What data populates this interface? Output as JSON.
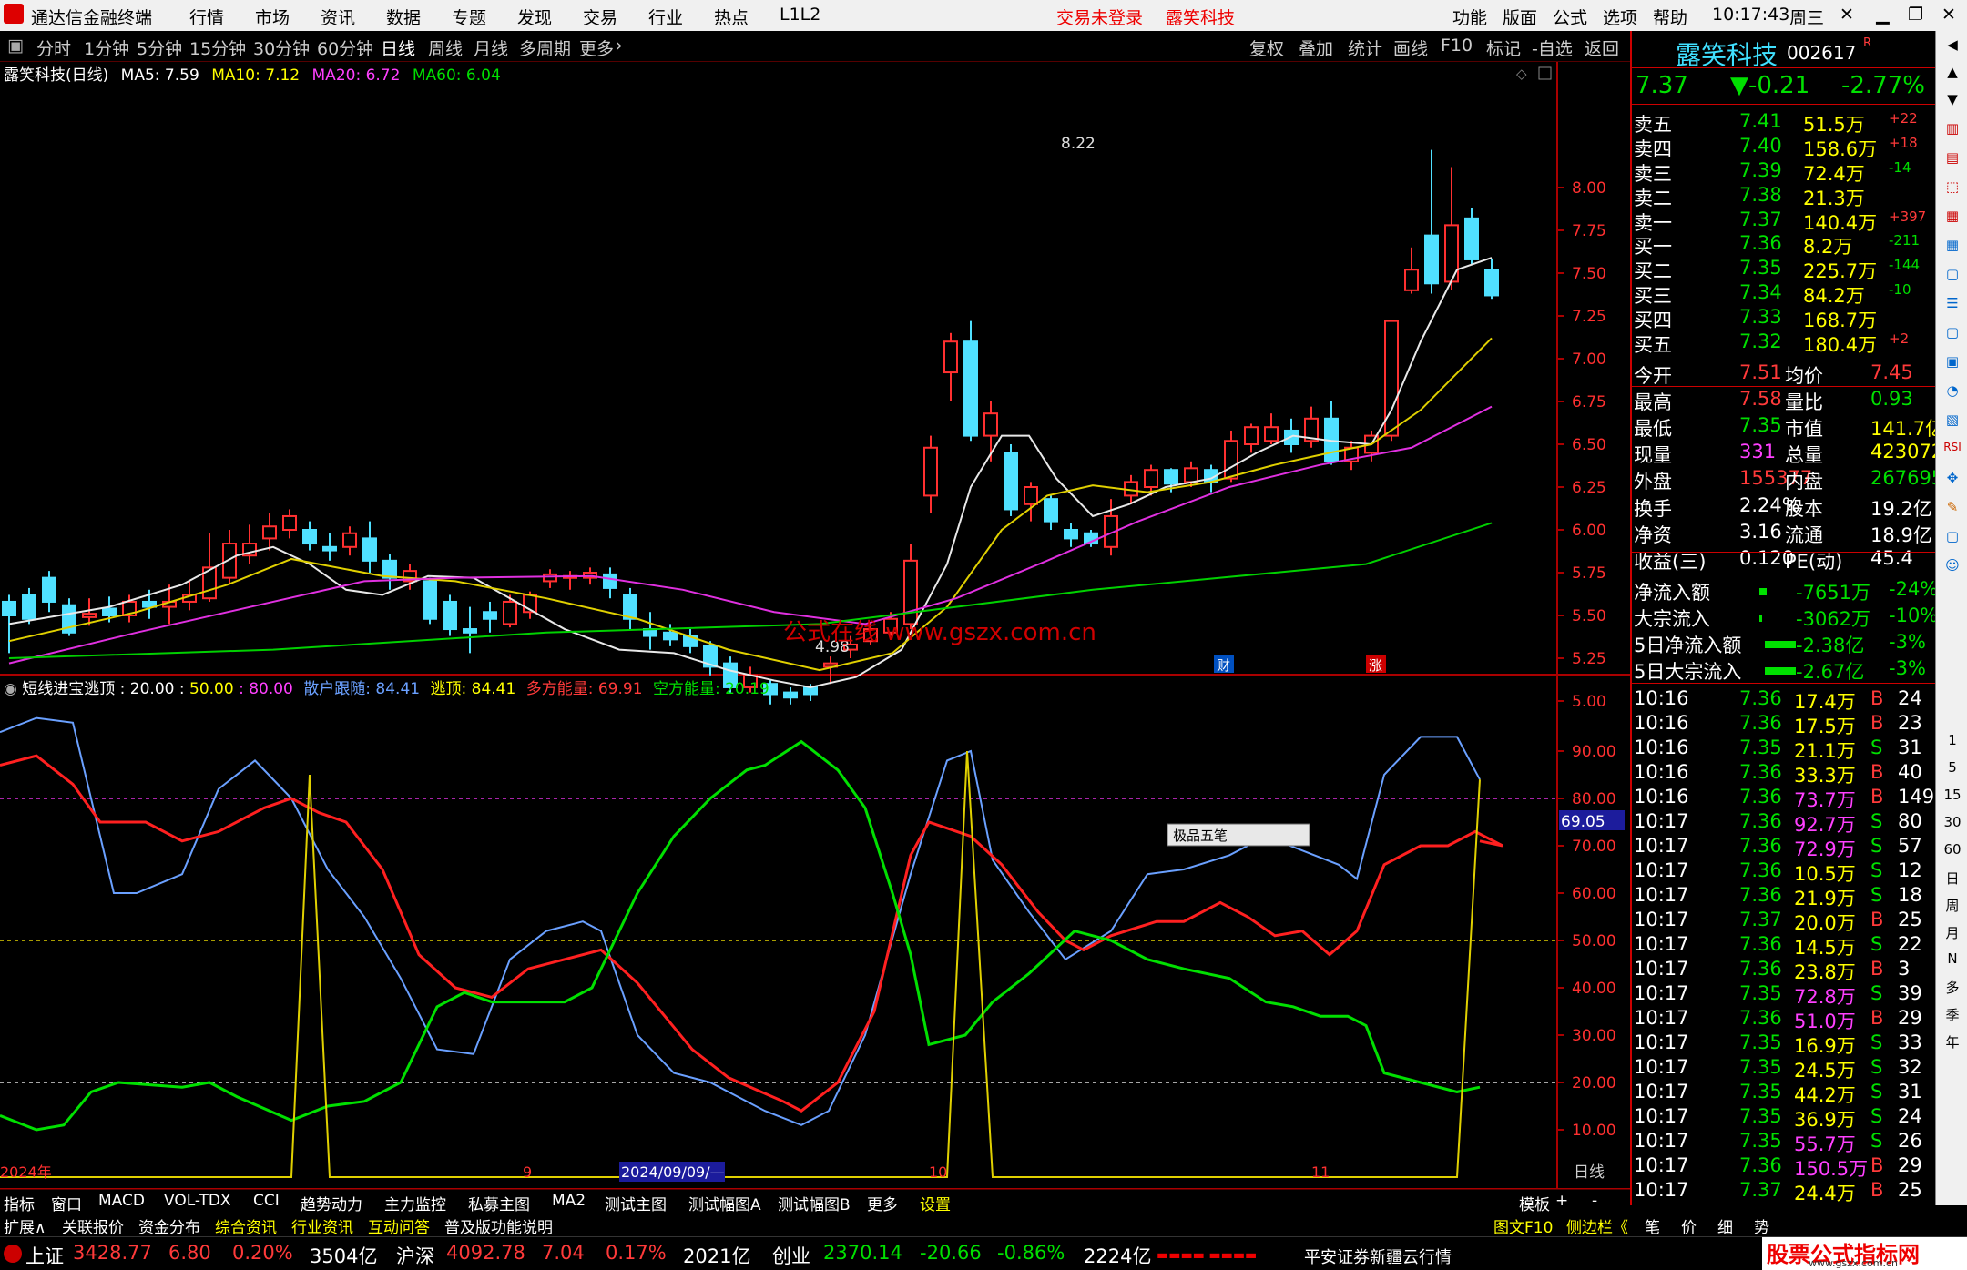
{
  "app": {
    "title": "通达信金融终端",
    "menu": [
      "行情",
      "市场",
      "资讯",
      "数据",
      "专题",
      "发现",
      "交易",
      "行业",
      "热点",
      "L1L2"
    ],
    "login": "交易未登录",
    "stock_link": "露笑科技",
    "right_menu": [
      "功能",
      "版面",
      "公式",
      "选项",
      "帮助"
    ],
    "time": "10:17:43",
    "weekday": "周三"
  },
  "periods": [
    "分时",
    "1分钟",
    "5分钟",
    "15分钟",
    "30分钟",
    "60分钟",
    "日线",
    "周线",
    "月线",
    "多周期",
    "更多"
  ],
  "tools": [
    "复权",
    "叠加",
    "统计",
    "画线",
    "F10",
    "标记",
    "-自选",
    "返回"
  ],
  "ma": {
    "name": "露笑科技(日线)",
    "ma5": "MA5: 7.59",
    "ma10": "MA10: 7.12",
    "ma20": "MA20: 6.72",
    "ma60": "MA60: 6.04"
  },
  "chart_data": {
    "type": "candlestick",
    "high_label": "8.22",
    "low_label": "4.98",
    "yaxis": [
      "8.00",
      "7.75",
      "7.50",
      "7.25",
      "7.00",
      "6.75",
      "6.50",
      "6.25",
      "6.00",
      "5.75",
      "5.50",
      "5.25",
      "5.00"
    ],
    "ylim": [
      4.9,
      8.3
    ],
    "watermark": "公式在线   www.gszx.com.cn",
    "badges": [
      "财",
      "涨"
    ]
  },
  "indicator": {
    "name": "短线进宝逃顶",
    "p1": ": 20.00 :",
    "p2": "50.00",
    "p3": ": 80.00",
    "s1": "散户跟随: 84.41",
    "s2": "逃顶: 84.41",
    "s3": "多方能量: 69.91",
    "s4": "空方能量: 20.19",
    "yaxis": [
      "90.00",
      "80.00",
      "70.00",
      "60.00",
      "50.00",
      "40.00",
      "30.00",
      "20.00",
      "10.00"
    ],
    "cursor": "69.05",
    "popup": "极品五笔"
  },
  "xaxis": {
    "year": "2024年",
    "m9": "9",
    "date": "2024/09/09/—",
    "m10": "10",
    "m11": "11",
    "period": "日线"
  },
  "quote": {
    "name": "露笑科技",
    "code": "002617",
    "r": "R",
    "price": "7.37",
    "change": "▼-0.21",
    "pct": "-2.77%",
    "asks": [
      [
        "卖五",
        "7.41",
        "51.5万",
        "+22"
      ],
      [
        "卖四",
        "7.40",
        "158.6万",
        "+18"
      ],
      [
        "卖三",
        "7.39",
        "72.4万",
        "-14"
      ],
      [
        "卖二",
        "7.38",
        "21.3万",
        ""
      ],
      [
        "卖一",
        "7.37",
        "140.4万",
        "+397"
      ]
    ],
    "bids": [
      [
        "买一",
        "7.36",
        "8.2万",
        "-211"
      ],
      [
        "买二",
        "7.35",
        "225.7万",
        "-144"
      ],
      [
        "买三",
        "7.34",
        "84.2万",
        "-10"
      ],
      [
        "买四",
        "7.33",
        "168.7万",
        ""
      ],
      [
        "买五",
        "7.32",
        "180.4万",
        "+2"
      ]
    ],
    "stats": [
      [
        "今开",
        "7.51",
        "均价",
        "7.45"
      ],
      [
        "最高",
        "7.58",
        "量比",
        "0.93"
      ],
      [
        "最低",
        "7.35",
        "市值",
        "141.7亿"
      ],
      [
        "现量",
        "331",
        "总量",
        "423072"
      ],
      [
        "外盘",
        "155377",
        "内盘",
        "267695"
      ]
    ],
    "fin": [
      [
        "换手",
        "2.24%",
        "股本",
        "19.2亿"
      ],
      [
        "净资",
        "3.16",
        "流通",
        "18.9亿"
      ],
      [
        "收益(三)",
        "0.120",
        "PE(动)",
        "45.4"
      ]
    ],
    "flow": [
      [
        "净流入额",
        "-7651万",
        "-24%"
      ],
      [
        "大宗流入",
        "-3062万",
        "-10%"
      ],
      [
        "5日净流入额",
        "-2.38亿",
        "-3%"
      ],
      [
        "5日大宗流入",
        "-2.67亿",
        "-3%"
      ]
    ],
    "ticks": [
      [
        "10:16",
        "7.36",
        "17.4万",
        "B",
        "24"
      ],
      [
        "10:16",
        "7.36",
        "17.5万",
        "B",
        "23"
      ],
      [
        "10:16",
        "7.35",
        "21.1万",
        "S",
        "31"
      ],
      [
        "10:16",
        "7.36",
        "33.3万",
        "B",
        "40"
      ],
      [
        "10:16",
        "7.36",
        "73.7万",
        "B",
        "149"
      ],
      [
        "10:17",
        "7.36",
        "92.7万",
        "S",
        "80"
      ],
      [
        "10:17",
        "7.36",
        "72.9万",
        "S",
        "57"
      ],
      [
        "10:17",
        "7.36",
        "10.5万",
        "S",
        "12"
      ],
      [
        "10:17",
        "7.36",
        "21.9万",
        "S",
        "18"
      ],
      [
        "10:17",
        "7.37",
        "20.0万",
        "B",
        "25"
      ],
      [
        "10:17",
        "7.36",
        "14.5万",
        "S",
        "22"
      ],
      [
        "10:17",
        "7.36",
        "23.8万",
        "B",
        "3"
      ],
      [
        "10:17",
        "7.35",
        "72.8万",
        "S",
        "39"
      ],
      [
        "10:17",
        "7.36",
        "51.0万",
        "B",
        "29"
      ],
      [
        "10:17",
        "7.35",
        "16.9万",
        "S",
        "33"
      ],
      [
        "10:17",
        "7.35",
        "24.5万",
        "S",
        "32"
      ],
      [
        "10:17",
        "7.35",
        "44.2万",
        "S",
        "31"
      ],
      [
        "10:17",
        "7.35",
        "36.9万",
        "S",
        "24"
      ],
      [
        "10:17",
        "7.35",
        "55.7万",
        "S",
        "26"
      ],
      [
        "10:17",
        "7.36",
        "150.5万",
        "B",
        "29"
      ],
      [
        "10:17",
        "7.37",
        "24.4万",
        "B",
        "25"
      ]
    ]
  },
  "tabs1": [
    "指标",
    "窗口",
    "MACD",
    "VOL-TDX",
    "CCI",
    "趋势动力",
    "主力监控",
    "私募主图",
    "MA2",
    "测试主图",
    "测试幅图A",
    "测试幅图B",
    "更多",
    "设置"
  ],
  "tabs1_right": [
    "模板",
    "+",
    "-"
  ],
  "tabs2": [
    "扩展∧",
    "关联报价",
    "资金分布",
    "综合资讯",
    "行业资讯",
    "互动问答",
    "普及版功能说明"
  ],
  "tabs2_right": [
    "图文F10",
    "侧边栏《",
    "笔",
    "价",
    "细",
    "势"
  ],
  "status": {
    "sh": "上证",
    "sh_v": "3428.77",
    "sh_c": "6.80",
    "sh_p": "0.20%",
    "sh_a": "3504亿",
    "sz": "沪深",
    "sz_v": "4092.78",
    "sz_c": "7.04",
    "sz_p": "0.17%",
    "sz_a": "2021亿",
    "cy": "创业",
    "cy_v": "2370.14",
    "cy_c": "-20.66",
    "cy_p": "-0.86%",
    "cy_a": "2224亿",
    "broker": "平安证券新疆云行情",
    "logo": "股票公式指标网",
    "logo_url": "www.gszx.com.cn"
  },
  "sidebar": [
    "1",
    "5",
    "15",
    "30",
    "60",
    "日",
    "周",
    "月",
    "N",
    "多",
    "季",
    "年"
  ]
}
